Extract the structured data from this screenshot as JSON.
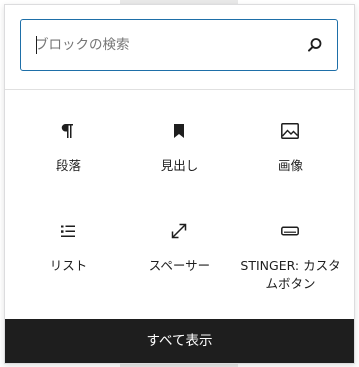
{
  "search": {
    "placeholder": "ブロックの検索",
    "value": ""
  },
  "blocks": [
    {
      "label": "段落",
      "icon": "paragraph-icon"
    },
    {
      "label": "見出し",
      "icon": "bookmark-icon"
    },
    {
      "label": "画像",
      "icon": "image-icon"
    },
    {
      "label": "リスト",
      "icon": "list-icon"
    },
    {
      "label": "スペーサー",
      "icon": "resize-icon"
    },
    {
      "label": "STINGER: カスタムボタン",
      "icon": "button-icon"
    }
  ],
  "footer": {
    "label": "すべて表示"
  },
  "colors": {
    "accent": "#1e6fa8",
    "footer_bg": "#1e1e1e",
    "text": "#1e1e1e"
  }
}
